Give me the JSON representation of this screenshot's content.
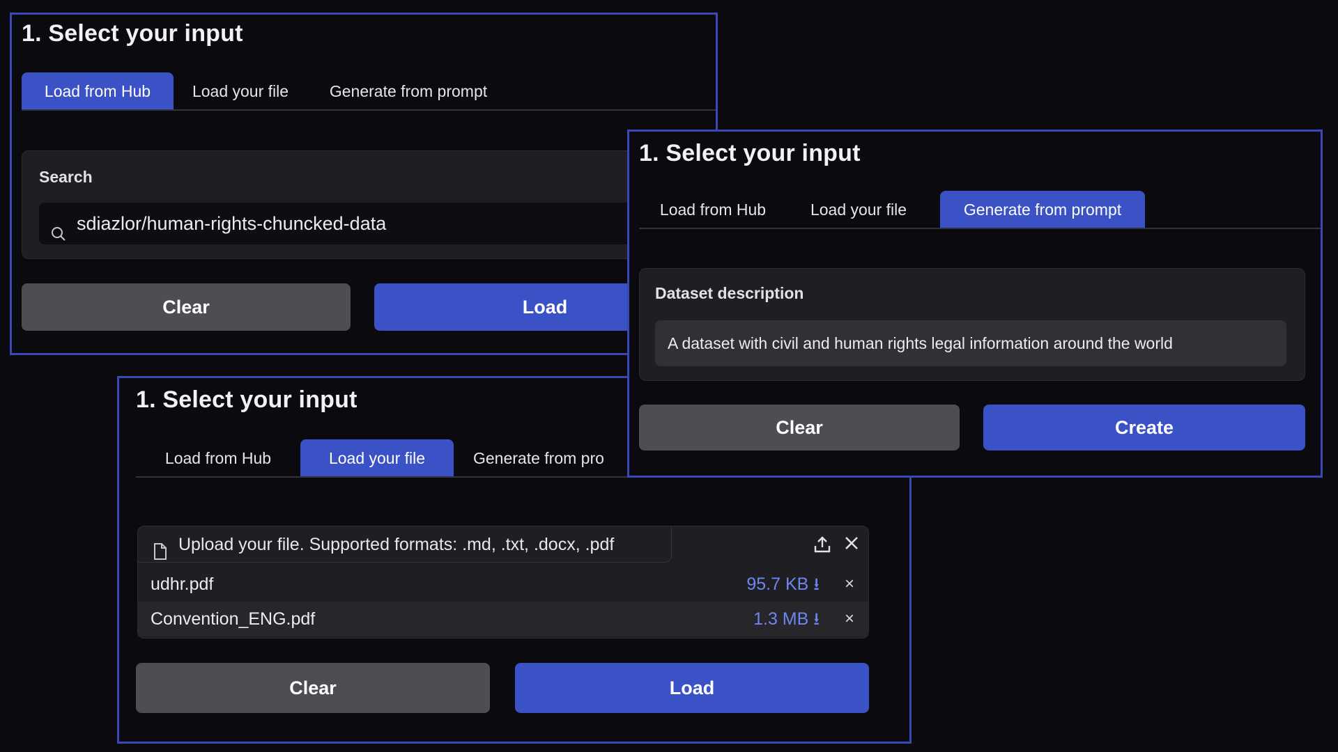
{
  "panels": {
    "hub": {
      "title": "1. Select your input",
      "tabs": [
        "Load from Hub",
        "Load your file",
        "Generate from prompt"
      ],
      "search_label": "Search",
      "search_value": "sdiazlor/human-rights-chuncked-data",
      "clear_label": "Clear",
      "load_label": "Load"
    },
    "file": {
      "title": "1. Select your input",
      "tabs": [
        "Load from Hub",
        "Load your file",
        "Generate from pro"
      ],
      "upload_label": "Upload your file. Supported formats: .md, .txt, .docx, .pdf",
      "files": [
        {
          "name": "udhr.pdf",
          "size": "95.7 KB ⭳",
          "remove": "×"
        },
        {
          "name": "Convention_ENG.pdf",
          "size": "1.3 MB ⭳",
          "remove": "×"
        }
      ],
      "clear_label": "Clear",
      "load_label": "Load"
    },
    "prompt": {
      "title": "1. Select your input",
      "tabs": [
        "Load from Hub",
        "Load your file",
        "Generate from prompt"
      ],
      "description_label": "Dataset description",
      "description_value": "A dataset with civil and human rights legal information around the world",
      "clear_label": "Clear",
      "create_label": "Create"
    }
  },
  "icons": {
    "search": "search-icon",
    "file": "file-icon",
    "upload": "upload-icon",
    "close": "close-icon"
  },
  "colors": {
    "background": "#0b0b0f",
    "panel_border": "#3848b4",
    "accent": "#3b52c6",
    "secondary_button": "#4d4d54",
    "file_size": "#6f86f0"
  }
}
